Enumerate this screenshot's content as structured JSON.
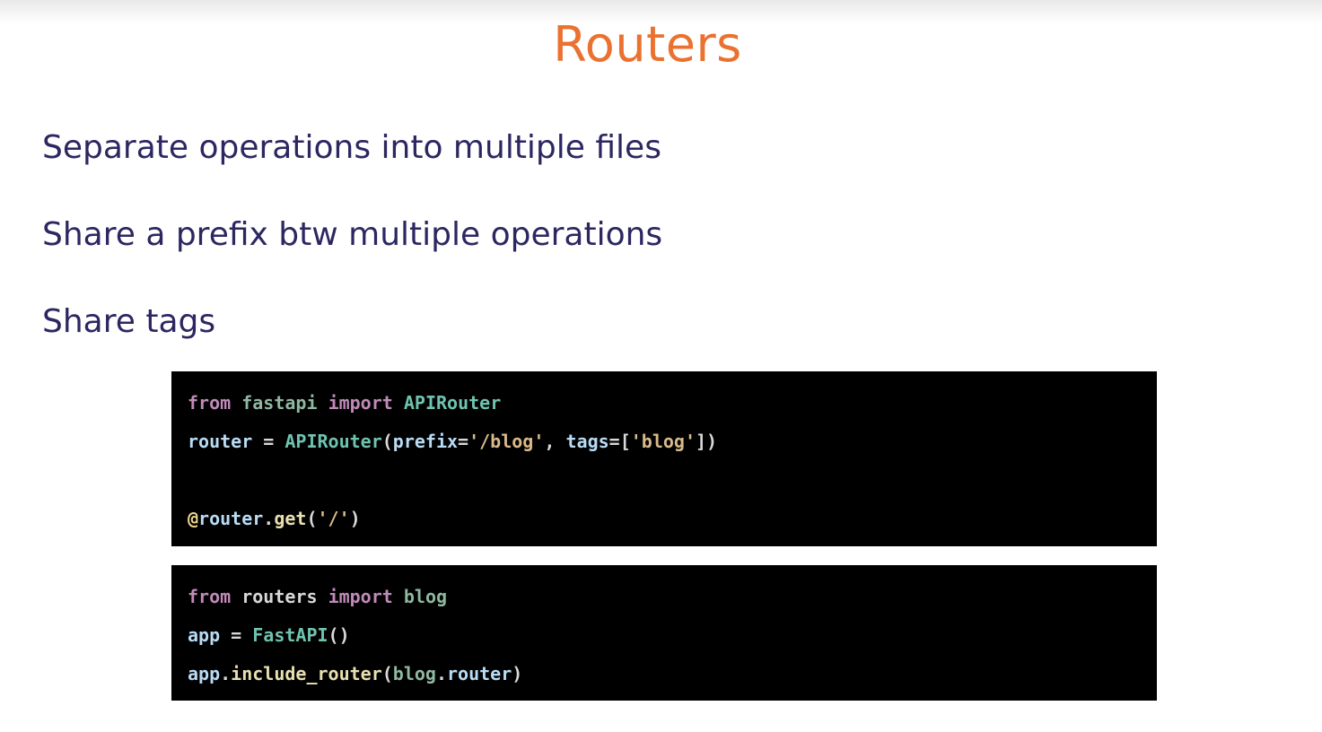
{
  "slide": {
    "title": "Routers",
    "bullets": [
      "Separate operations into multiple files",
      "Share a prefix btw multiple operations",
      "Share tags"
    ]
  },
  "code_blocks": [
    {
      "lines": [
        [
          "from",
          " ",
          "fastapi",
          " ",
          "import",
          " ",
          "APIRouter"
        ],
        [
          "router",
          " = ",
          "APIRouter",
          "(",
          "prefix",
          "=",
          "'/blog'",
          ", ",
          "tags",
          "=[",
          "'blog'",
          "])"
        ],
        [],
        [
          "@",
          "router",
          ".",
          "get",
          "(",
          "'/'",
          ")"
        ]
      ]
    },
    {
      "lines": [
        [
          "from",
          " ",
          "routers",
          " ",
          "import",
          " ",
          "blog"
        ],
        [
          "app",
          " = ",
          "FastAPI",
          "()"
        ],
        [
          "app",
          ".",
          "include_router",
          "(",
          "blog",
          ".",
          "router",
          ")"
        ]
      ]
    }
  ],
  "colors": {
    "title": "#ea7130",
    "bullet_text": "#2c2761",
    "code_background": "#000000"
  }
}
